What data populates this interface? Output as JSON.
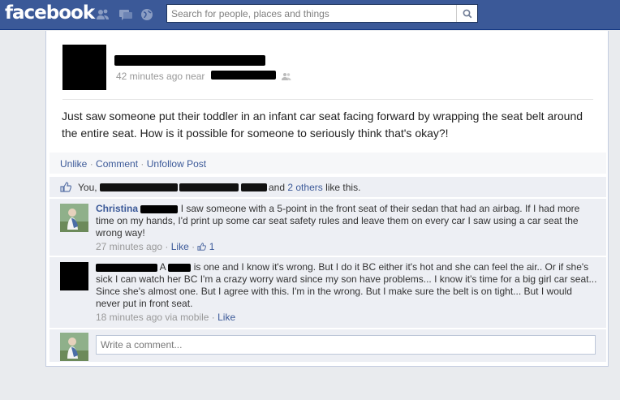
{
  "header": {
    "logo": "facebook",
    "search_placeholder": "Search for people, places and things"
  },
  "post": {
    "time": "42 minutes ago near",
    "text": "Just saw someone put their toddler in an infant car seat facing forward by wrapping the seat belt around the entire seat. How is it possible for someone to seriously think that's okay?!"
  },
  "actions": {
    "unlike": "Unlike",
    "comment": "Comment",
    "unfollow": "Unfollow Post",
    "sep": "·"
  },
  "likes": {
    "you": "You,",
    "and": "and",
    "others": "2 others",
    "tail": "like this."
  },
  "comments": [
    {
      "author": "Christina",
      "text": "I saw someone with a 5-point in the front seat of their sedan that had an airbag. If I had more time on my hands, I'd print up some car seat safety rules and leave them on every car I saw using a car seat the wrong way!",
      "time": "27 minutes ago",
      "like": "Like",
      "like_count": "1"
    },
    {
      "text_a": "A",
      "text_b": "is one and I know it's wrong. But I do it BC either it's hot and she can feel the air.. Or if she's sick I can watch her BC I'm a crazy worry ward since my son have problems... I know it's time for a big girl car seat... Since she's almost one. But I agree with this. I'm in the wrong. But I make sure the belt is on tight... But I would never put in front seat.",
      "time": "18 minutes ago via mobile",
      "like": "Like"
    }
  ],
  "write_comment_placeholder": "Write a comment...",
  "colors": {
    "brand": "#3b5998",
    "ufi_bg": "#edeff4"
  }
}
